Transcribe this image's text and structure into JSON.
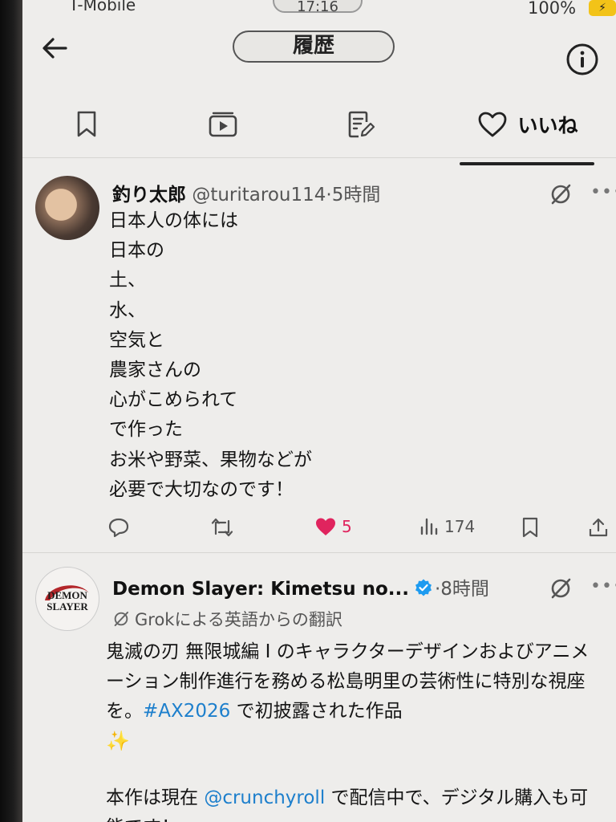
{
  "status_bar": {
    "carrier": "T-Mobile",
    "time": "17:16",
    "battery": "100%"
  },
  "header": {
    "title": "履歴"
  },
  "tabs": [
    {
      "id": "bookmarks",
      "icon": "bookmark-icon",
      "label": ""
    },
    {
      "id": "video",
      "icon": "video-icon",
      "label": ""
    },
    {
      "id": "lists",
      "icon": "list-edit-icon",
      "label": ""
    },
    {
      "id": "likes",
      "icon": "heart-icon",
      "label": "いいね",
      "selected": true
    }
  ],
  "posts": [
    {
      "author": "釣り太郎",
      "handle": "@turitarou114",
      "separator": "·",
      "time": "5時間",
      "body_lines": [
        "日本人の体には",
        "日本の",
        "土、",
        "水、",
        "空気と",
        "農家さんの",
        "心がこめられて",
        "で作った",
        "お米や野菜、果物などが",
        "必要で大切なのです！"
      ],
      "actions": {
        "replies": "",
        "reposts": "",
        "likes": "5",
        "views": "174"
      },
      "liked": true,
      "like_color": "#e0245e"
    },
    {
      "author": "Demon Slayer: Kimetsu no...",
      "verified": true,
      "separator": "·",
      "time": "8時間",
      "avatar_text": [
        "DEMON",
        "SLAYER"
      ],
      "translation_note": "Grokによる英語からの翻訳",
      "body_p1_before": "鬼滅の刃 無限城編 I のキャラクターデザインおよびアニメーション制作進行を務める松島明里の芸術性に特別な視座を。",
      "hashtag": "#AX2026",
      "body_p1_after": " で初披露された作品",
      "sparkle": "✨",
      "body_p2_before": "本作は現在 ",
      "mention": "@crunchyroll",
      "body_p2_after": " で配信中で、デジタル購入も可能です！"
    }
  ],
  "colors": {
    "link": "#1d7fcc",
    "verified": "#1d9bf0",
    "like": "#e0245e"
  }
}
